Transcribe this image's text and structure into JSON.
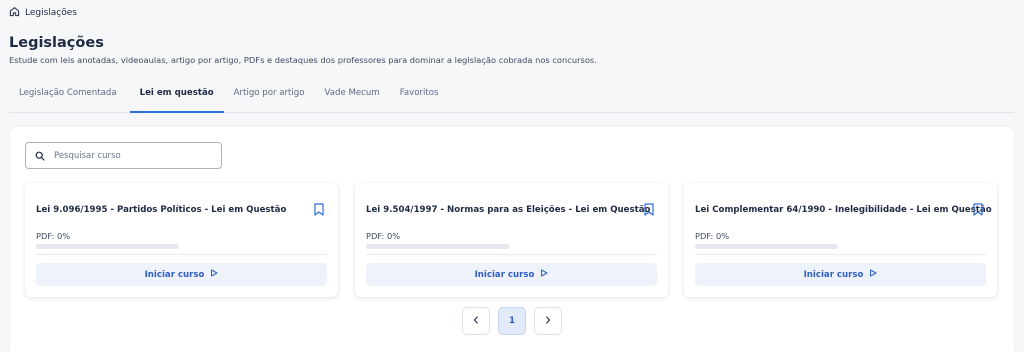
{
  "breadcrumb": {
    "icon": "home-icon",
    "label": "Legislações"
  },
  "header": {
    "title": "Legislações",
    "subtitle": "Estude com leis anotadas, videoaulas, artigo por artigo, PDFs e destaques dos professores para dominar a legislação cobrada nos concursos."
  },
  "tabs": [
    {
      "label": "Legislação Comentada",
      "active": false
    },
    {
      "label": "Lei em questão",
      "active": true
    },
    {
      "label": "Artigo por artigo",
      "active": false
    },
    {
      "label": "Vade Mecum",
      "active": false
    },
    {
      "label": "Favoritos",
      "active": false
    }
  ],
  "search": {
    "placeholder": "Pesquisar curso",
    "value": "",
    "icon": "search-icon"
  },
  "courses": [
    {
      "title": "Lei 9.096/1995 - Partidos Políticos - Lei em Questão",
      "pdf_label": "PDF: 0%",
      "progress": 0,
      "button_label": "Iniciar curso",
      "bookmark_icon": "bookmark-icon"
    },
    {
      "title": "Lei 9.504/1997 - Normas para as Eleições - Lei em Questão",
      "pdf_label": "PDF: 0%",
      "progress": 0,
      "button_label": "Iniciar curso",
      "bookmark_icon": "bookmark-icon"
    },
    {
      "title": "Lei Complementar 64/1990 - Inelegibilidade - Lei em Questão",
      "pdf_label": "PDF: 0%",
      "progress": 0,
      "button_label": "Iniciar curso",
      "bookmark_icon": "bookmark-icon"
    }
  ],
  "pagination": {
    "current_page": "1",
    "prev_icon": "chevron-left-icon",
    "next_icon": "chevron-right-icon"
  },
  "colors": {
    "accent": "#2f6bd9",
    "button_bg": "#eef2fa",
    "text": "#1f2a44"
  }
}
